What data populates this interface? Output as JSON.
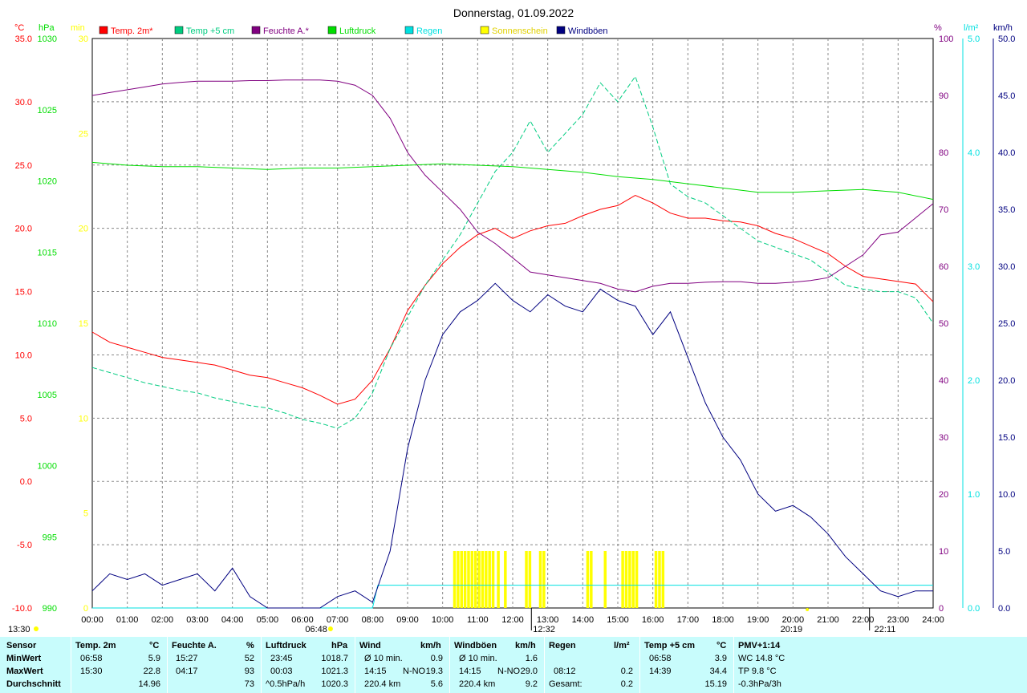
{
  "title": "Donnerstag, 01.09.2022",
  "axes": {
    "temp": {
      "unit": "°C",
      "min": -10,
      "max": 35,
      "ticks": [
        "35.0",
        "30.0",
        "25.0",
        "20.0",
        "15.0",
        "10.0",
        "5.0",
        "0.0",
        "-5.0",
        "-10.0"
      ]
    },
    "pressure": {
      "unit": "hPa",
      "min": 990,
      "max": 1030,
      "ticks": [
        "1030",
        "1025",
        "1020",
        "1015",
        "1010",
        "1005",
        "1000",
        "995",
        "990"
      ]
    },
    "sunshine": {
      "unit": "min",
      "min": 0,
      "max": 30,
      "ticks": [
        "30",
        "25",
        "20",
        "15",
        "10",
        "5",
        "0"
      ]
    },
    "humidity": {
      "unit": "%",
      "min": 0,
      "max": 100,
      "ticks": [
        "100",
        "90",
        "80",
        "70",
        "60",
        "50",
        "40",
        "30",
        "20",
        "10",
        "0"
      ]
    },
    "rain": {
      "unit": "l/m²",
      "min": 0,
      "max": 5,
      "ticks": [
        "5.0",
        "4.0",
        "3.0",
        "2.0",
        "1.0",
        "0.0"
      ]
    },
    "wind": {
      "unit": "km/h",
      "min": 0,
      "max": 50,
      "ticks": [
        "50.0",
        "45.0",
        "40.0",
        "35.0",
        "30.0",
        "25.0",
        "20.0",
        "15.0",
        "10.0",
        "5.0",
        "0.0"
      ]
    },
    "time_ticks": [
      "00:00",
      "01:00",
      "02:00",
      "03:00",
      "04:00",
      "05:00",
      "06:00",
      "07:00",
      "08:00",
      "09:00",
      "10:00",
      "11:00",
      "12:00",
      "13:00",
      "14:00",
      "15:00",
      "16:00",
      "17:00",
      "18:00",
      "19:00",
      "20:00",
      "21:00",
      "22:00",
      "23:00",
      "24:00"
    ]
  },
  "legend": [
    {
      "label": "Temp. 2m*",
      "color": "#ff0000"
    },
    {
      "label": "Temp +5 cm",
      "color": "#00cc80"
    },
    {
      "label": "Feuchte A.*",
      "color": "#800080"
    },
    {
      "label": "Luftdruck",
      "color": "#00dd00"
    },
    {
      "label": "Regen",
      "color": "#00e0e0"
    },
    {
      "label": "Sonnenschein",
      "color": "#ffff00"
    },
    {
      "label": "Windböen",
      "color": "#000080"
    }
  ],
  "markers": {
    "moon_left": "13:30",
    "sunrise": "06:48",
    "solar_noon": "12:32",
    "sunset": "20:19",
    "moon_right": "22:11"
  },
  "colors": {
    "temp2m": "#ff0000",
    "temp5cm": "#00cc80",
    "humidity": "#800080",
    "pressure": "#00dd00",
    "rain": "#00e0e0",
    "sunshine": "#ffff00",
    "wind": "#000080",
    "table_bg": "#c8fcfc"
  },
  "chart_data": {
    "type": "line",
    "title": "Donnerstag, 01.09.2022",
    "x_unit": "hour",
    "xlim": [
      0,
      24
    ],
    "grid": true,
    "legend_position": "top",
    "series": [
      {
        "name": "Temp. 2m*",
        "axis": "temp",
        "x": [
          0,
          0.5,
          1,
          1.5,
          2,
          2.5,
          3,
          3.5,
          4,
          4.5,
          5,
          5.5,
          6,
          6.5,
          7,
          7.5,
          8,
          8.5,
          9,
          9.5,
          10,
          10.5,
          11,
          11.5,
          12,
          12.5,
          13,
          13.5,
          14,
          14.5,
          15,
          15.5,
          16,
          16.5,
          17,
          17.5,
          18,
          18.5,
          19,
          19.5,
          20,
          20.5,
          21,
          21.5,
          22,
          22.5,
          23,
          23.5,
          24
        ],
        "y": [
          11.8,
          11.0,
          10.6,
          10.2,
          9.8,
          9.6,
          9.4,
          9.2,
          8.8,
          8.4,
          8.2,
          7.8,
          7.4,
          6.8,
          6.1,
          6.5,
          8.0,
          10.5,
          13.5,
          15.5,
          17.2,
          18.5,
          19.5,
          20.0,
          19.2,
          19.8,
          20.2,
          20.4,
          21.0,
          21.5,
          21.8,
          22.6,
          22.0,
          21.2,
          20.8,
          20.8,
          20.6,
          20.5,
          20.2,
          19.6,
          19.2,
          18.6,
          18.0,
          17.0,
          16.2,
          16.0,
          15.8,
          15.6,
          14.2
        ]
      },
      {
        "name": "Temp +5 cm",
        "axis": "temp",
        "x": [
          0,
          0.5,
          1,
          1.5,
          2,
          2.5,
          3,
          3.5,
          4,
          4.5,
          5,
          5.5,
          6,
          6.5,
          7,
          7.5,
          8,
          8.5,
          9,
          9.5,
          10,
          10.5,
          11,
          11.5,
          12,
          12.5,
          13,
          13.5,
          14,
          14.5,
          15,
          15.5,
          16,
          16.5,
          17,
          17.5,
          18,
          18.5,
          19,
          19.5,
          20,
          20.5,
          21,
          21.5,
          22,
          22.5,
          23,
          23.5,
          24
        ],
        "y": [
          9.0,
          8.6,
          8.2,
          7.8,
          7.5,
          7.2,
          7.0,
          6.6,
          6.3,
          6.0,
          5.8,
          5.4,
          4.9,
          4.6,
          4.2,
          5.0,
          7.0,
          10.5,
          13.0,
          15.5,
          17.5,
          19.5,
          22.0,
          24.5,
          26.0,
          28.5,
          26.0,
          27.5,
          29.0,
          31.5,
          30.0,
          32.0,
          28.0,
          23.5,
          22.5,
          22.0,
          21.0,
          20.0,
          19.0,
          18.5,
          18.0,
          17.5,
          16.5,
          15.5,
          15.2,
          15.0,
          15.0,
          14.5,
          12.5
        ]
      },
      {
        "name": "Feuchte A.*",
        "axis": "humidity",
        "x": [
          0,
          0.5,
          1,
          1.5,
          2,
          2.5,
          3,
          3.5,
          4,
          4.5,
          5,
          5.5,
          6,
          6.5,
          7,
          7.5,
          8,
          8.5,
          9,
          9.5,
          10,
          10.5,
          11,
          11.5,
          12,
          12.5,
          13,
          13.5,
          14,
          14.5,
          15,
          15.5,
          16,
          16.5,
          17,
          17.5,
          18,
          18.5,
          19,
          19.5,
          20,
          20.5,
          21,
          21.5,
          22,
          22.5,
          23,
          23.5,
          24
        ],
        "y": [
          90,
          90.5,
          91,
          91.5,
          92,
          92.3,
          92.5,
          92.5,
          92.5,
          92.6,
          92.6,
          92.7,
          92.7,
          92.7,
          92.5,
          91.8,
          90.0,
          86.0,
          80.0,
          76.0,
          73.0,
          70.0,
          66.0,
          64.0,
          61.5,
          59.0,
          58.5,
          58.0,
          57.5,
          57.0,
          56.0,
          55.5,
          56.5,
          57.0,
          57.0,
          57.2,
          57.3,
          57.3,
          57.0,
          57.0,
          57.2,
          57.5,
          58.0,
          60.0,
          62.0,
          65.5,
          66.0,
          68.5,
          71.0
        ]
      },
      {
        "name": "Luftdruck",
        "axis": "pressure",
        "x": [
          0,
          1,
          2,
          3,
          4,
          5,
          6,
          7,
          8,
          9,
          10,
          11,
          12,
          13,
          14,
          15,
          16,
          17,
          18,
          19,
          20,
          21,
          22,
          23,
          24
        ],
        "y": [
          1021.3,
          1021.1,
          1021.0,
          1021.0,
          1020.9,
          1020.8,
          1020.9,
          1020.9,
          1021.0,
          1021.1,
          1021.2,
          1021.1,
          1021.0,
          1020.8,
          1020.6,
          1020.3,
          1020.1,
          1019.8,
          1019.5,
          1019.2,
          1019.2,
          1019.3,
          1019.4,
          1019.2,
          1018.7
        ]
      },
      {
        "name": "Regen",
        "axis": "rain",
        "x": [
          0,
          8.0,
          8.15,
          24
        ],
        "y": [
          0,
          0,
          0.2,
          0.2
        ]
      },
      {
        "name": "Windböen",
        "axis": "wind",
        "x": [
          0,
          0.5,
          1,
          1.5,
          2,
          2.5,
          3,
          3.5,
          4,
          4.5,
          5,
          5.5,
          6,
          6.5,
          7,
          7.5,
          8,
          8.5,
          9,
          9.5,
          10,
          10.5,
          11,
          11.5,
          12,
          12.5,
          13,
          13.5,
          14,
          14.5,
          15,
          15.5,
          16,
          16.5,
          17,
          17.5,
          18,
          18.5,
          19,
          19.5,
          20,
          20.5,
          21,
          21.5,
          22,
          22.5,
          23,
          23.5,
          24
        ],
        "y": [
          1.5,
          3.0,
          2.5,
          3.0,
          2.0,
          2.5,
          3.0,
          1.5,
          3.5,
          1.0,
          0,
          0,
          0,
          0,
          1.0,
          1.5,
          0.5,
          5.0,
          14.0,
          20.0,
          24.0,
          26.0,
          27.0,
          28.5,
          27.0,
          26.0,
          27.5,
          26.5,
          26.0,
          28.0,
          27.0,
          26.5,
          24.0,
          26.0,
          22.0,
          18.0,
          15.0,
          13.0,
          10.0,
          8.5,
          9.0,
          8.0,
          6.5,
          4.5,
          3.0,
          1.5,
          1.0,
          1.5,
          1.5
        ]
      }
    ],
    "sunshine_bars": {
      "axis": "sunshine",
      "x": [
        10.3,
        10.4,
        10.5,
        10.6,
        10.7,
        10.8,
        10.9,
        11.0,
        11.1,
        11.2,
        11.3,
        11.4,
        11.55,
        11.75,
        12.35,
        12.45,
        12.75,
        12.85,
        14.1,
        14.2,
        14.6,
        15.1,
        15.2,
        15.3,
        15.4,
        15.5,
        16.05,
        16.15,
        16.25
      ],
      "y": [
        3,
        3,
        3,
        3,
        3,
        3,
        3,
        3,
        3,
        3,
        3,
        3,
        3,
        3,
        3,
        3,
        3,
        3,
        3,
        3,
        3,
        3,
        3,
        3,
        3,
        3,
        3,
        3,
        3
      ]
    }
  },
  "table": {
    "headers": [
      "Sensor",
      "Temp. 2m",
      "°C",
      "Feuchte A.",
      "%",
      "Luftdruck",
      "hPa",
      "Wind",
      "km/h",
      "Windböen",
      "km/h",
      "Regen",
      "l/m²",
      "Temp +5 cm",
      "°C",
      "PMV+1:14"
    ],
    "rows": [
      {
        "label": "MinWert",
        "t2_time": "06:58",
        "t2_val": "5.9",
        "h_time": "15:27",
        "h_val": "52",
        "p_time": "23:45",
        "p_val": "1018.7",
        "w_lbl": "Ø 10 min.",
        "w_val": "0.9",
        "g_lbl": "Ø 10 min.",
        "g_val": "1.6",
        "r_lbl": "",
        "r_val": "",
        "t5_time": "06:58",
        "t5_val": "3.9",
        "pmv": "WC 14.8 °C"
      },
      {
        "label": "MaxWert",
        "t2_time": "15:30",
        "t2_val": "22.8",
        "h_time": "04:17",
        "h_val": "93",
        "p_time": "00:03",
        "p_val": "1021.3",
        "w_lbl": "14:15",
        "w_dir": "N-NO",
        "w_val": "19.3",
        "g_lbl": "14:15",
        "g_dir": "N-NO",
        "g_val": "29.0",
        "r_lbl": "08:12",
        "r_val": "0.2",
        "t5_time": "14:39",
        "t5_val": "34.4",
        "pmv": "TP 9.8 °C"
      },
      {
        "label": "Durchschnitt",
        "t2_time": "",
        "t2_val": "14.96",
        "h_time": "",
        "h_val": "73",
        "p_time": "^0.5hPa/h",
        "p_val": "1020.3",
        "w_lbl": "220.4 km",
        "w_val": "5.6",
        "g_lbl": "220.4 km",
        "g_val": "9.2",
        "r_lbl": "Gesamt:",
        "r_val": "0.2",
        "t5_time": "",
        "t5_val": "15.19",
        "pmv": "-0.3hPa/3h"
      }
    ]
  }
}
